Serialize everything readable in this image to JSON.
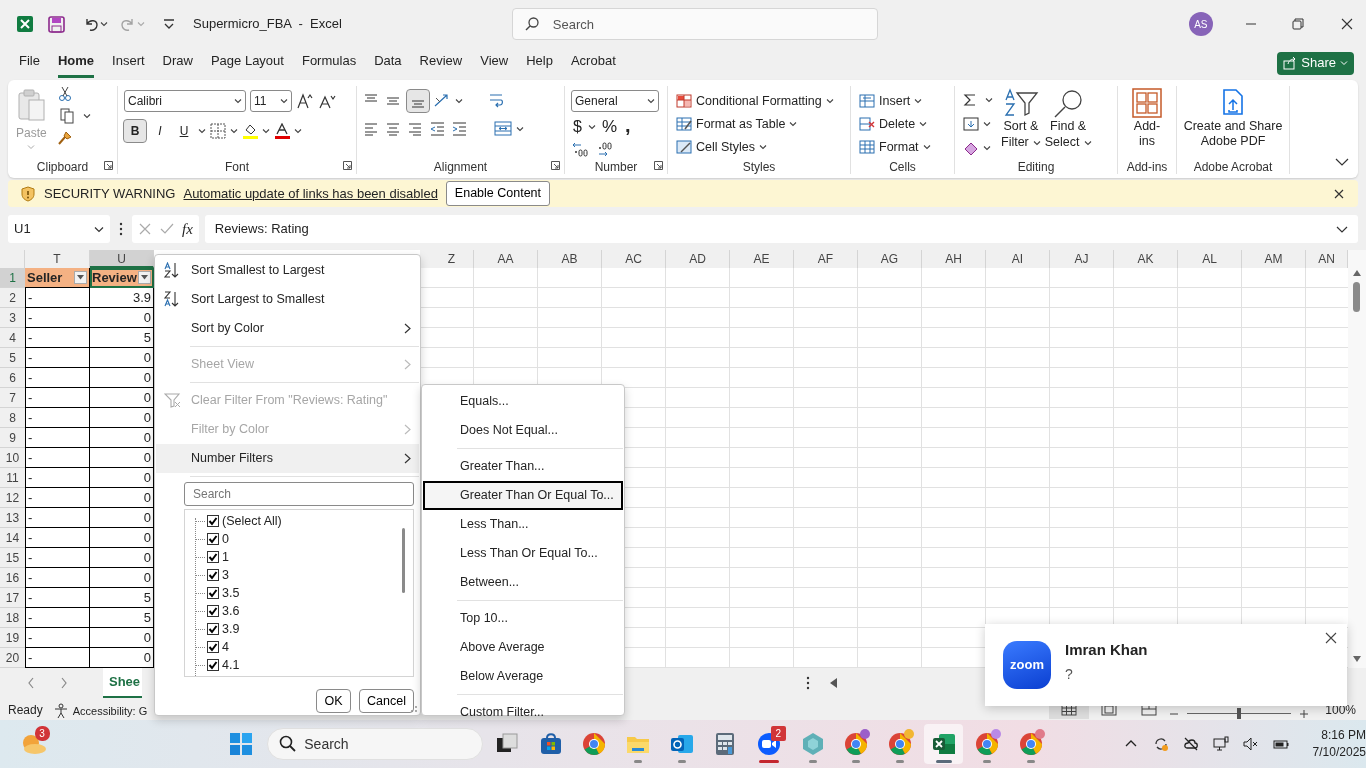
{
  "window": {
    "title": "Supermicro_FBA  -  Excel",
    "search_placeholder": "Search",
    "avatar": "AS"
  },
  "ribbon_tabs": [
    {
      "label": "File",
      "selected": false
    },
    {
      "label": "Home",
      "selected": true
    },
    {
      "label": "Insert",
      "selected": false
    },
    {
      "label": "Draw",
      "selected": false
    },
    {
      "label": "Page Layout",
      "selected": false
    },
    {
      "label": "Formulas",
      "selected": false
    },
    {
      "label": "Data",
      "selected": false
    },
    {
      "label": "Review",
      "selected": false
    },
    {
      "label": "View",
      "selected": false
    },
    {
      "label": "Help",
      "selected": false
    },
    {
      "label": "Acrobat",
      "selected": false
    }
  ],
  "share": "Share",
  "ribbon": {
    "clipboard": {
      "label": "Clipboard",
      "paste": "Paste"
    },
    "font": {
      "label": "Font",
      "name": "Calibri",
      "size": "11",
      "bold": "B",
      "italic": "I",
      "underline": "U",
      "bold_on": true
    },
    "alignment": {
      "label": "Alignment",
      "bottom_align_on": true
    },
    "number": {
      "label": "Number",
      "format": "General",
      "currency": "$",
      "percent": "%",
      "comma": ","
    },
    "styles": {
      "label": "Styles",
      "commands": [
        "Conditional Formatting",
        "Format as Table",
        "Cell Styles"
      ]
    },
    "cells": {
      "label": "Cells",
      "commands": [
        "Insert",
        "Delete",
        "Format"
      ]
    },
    "editing": {
      "label": "Editing",
      "sort_lines": [
        "Sort &",
        "Filter"
      ],
      "find_lines": [
        "Find &",
        "Select"
      ]
    },
    "addins": {
      "label": "Add-ins",
      "button": "Add-ins"
    },
    "acrobat": {
      "label": "Adobe Acrobat",
      "button": "Create and Share Adobe PDF"
    }
  },
  "security_bar": {
    "title": "SECURITY WARNING",
    "message": "Automatic update of links has been disabled",
    "button": "Enable Content"
  },
  "formula_bar": {
    "name_box": "U1",
    "fx": "fx",
    "formula": "Reviews: Rating"
  },
  "sheet": {
    "columns_left": [
      "T",
      "U"
    ],
    "columns_right": [
      "Z",
      "AA",
      "AB",
      "AC",
      "AD",
      "AE",
      "AF",
      "AG",
      "AH",
      "AI",
      "AJ",
      "AK",
      "AL",
      "AM",
      "AN"
    ],
    "header_row": {
      "number": "1",
      "cells": [
        {
          "text": "Seller",
          "selected": false
        },
        {
          "text": "Review",
          "selected": true
        }
      ]
    },
    "rows": [
      {
        "number": "2",
        "t": "-",
        "u": "3.9"
      },
      {
        "number": "3",
        "t": "-",
        "u": "0"
      },
      {
        "number": "4",
        "t": "-",
        "u": "5"
      },
      {
        "number": "5",
        "t": "-",
        "u": "0"
      },
      {
        "number": "6",
        "t": "-",
        "u": "0"
      },
      {
        "number": "7",
        "t": "-",
        "u": "0"
      },
      {
        "number": "8",
        "t": "-",
        "u": "0"
      },
      {
        "number": "9",
        "t": "-",
        "u": "0"
      },
      {
        "number": "10",
        "t": "-",
        "u": "0"
      },
      {
        "number": "11",
        "t": "-",
        "u": "0"
      },
      {
        "number": "12",
        "t": "-",
        "u": "0"
      },
      {
        "number": "13",
        "t": "-",
        "u": "0"
      },
      {
        "number": "14",
        "t": "-",
        "u": "0"
      },
      {
        "number": "15",
        "t": "-",
        "u": "0"
      },
      {
        "number": "16",
        "t": "-",
        "u": "0"
      },
      {
        "number": "17",
        "t": "-",
        "u": "5"
      },
      {
        "number": "18",
        "t": "-",
        "u": "5"
      },
      {
        "number": "19",
        "t": "-",
        "u": "0"
      },
      {
        "number": "20",
        "t": "-",
        "u": "0"
      }
    ],
    "sheet_tab": "Shee"
  },
  "filter_menu": {
    "items": [
      {
        "kind": "sort_asc",
        "label": "Sort Smallest to Largest",
        "disabled": false,
        "submenu": false,
        "highlighted": false
      },
      {
        "kind": "sort_desc",
        "label": "Sort Largest to Smallest",
        "disabled": false,
        "submenu": false,
        "highlighted": false
      },
      {
        "kind": "command",
        "label": "Sort by Color",
        "disabled": false,
        "submenu": true,
        "highlighted": false
      },
      {
        "kind": "separator"
      },
      {
        "kind": "command",
        "label": "Sheet View",
        "disabled": true,
        "submenu": true,
        "highlighted": false
      },
      {
        "kind": "separator"
      },
      {
        "kind": "clear_filter",
        "label": "Clear Filter From \"Reviews: Rating\"",
        "disabled": true,
        "submenu": false,
        "highlighted": false
      },
      {
        "kind": "command",
        "label": "Filter by Color",
        "disabled": true,
        "submenu": true,
        "highlighted": false
      },
      {
        "kind": "command",
        "label": "Number Filters",
        "disabled": false,
        "submenu": true,
        "highlighted": true
      },
      {
        "kind": "separator"
      }
    ],
    "search_placeholder": "Search",
    "values": [
      {
        "label": "(Select All)",
        "checked": true
      },
      {
        "label": "0",
        "checked": true
      },
      {
        "label": "1",
        "checked": true
      },
      {
        "label": "3",
        "checked": true
      },
      {
        "label": "3.5",
        "checked": true
      },
      {
        "label": "3.6",
        "checked": true
      },
      {
        "label": "3.9",
        "checked": true
      },
      {
        "label": "4",
        "checked": true
      },
      {
        "label": "4.1",
        "checked": true
      }
    ],
    "ok": "OK",
    "cancel": "Cancel"
  },
  "number_filters": [
    {
      "kind": "command",
      "label": "Equals...",
      "focused": false
    },
    {
      "kind": "command",
      "label": "Does Not Equal...",
      "focused": false
    },
    {
      "kind": "separator"
    },
    {
      "kind": "command",
      "label": "Greater Than...",
      "focused": false
    },
    {
      "kind": "command",
      "label": "Greater Than Or Equal To...",
      "focused": true
    },
    {
      "kind": "command",
      "label": "Less Than...",
      "focused": false
    },
    {
      "kind": "command",
      "label": "Less Than Or Equal To...",
      "focused": false
    },
    {
      "kind": "command",
      "label": "Between...",
      "focused": false
    },
    {
      "kind": "separator"
    },
    {
      "kind": "command",
      "label": "Top 10...",
      "focused": false
    },
    {
      "kind": "command",
      "label": "Above Average",
      "focused": false
    },
    {
      "kind": "command",
      "label": "Below Average",
      "focused": false
    },
    {
      "kind": "separator"
    },
    {
      "kind": "command",
      "label": "Custom Filter...",
      "focused": false
    }
  ],
  "status_bar": {
    "ready": "Ready",
    "accessibility": "Accessibility: G",
    "views": [
      {
        "kind": "normal",
        "selected": true
      },
      {
        "kind": "page_layout",
        "selected": false
      },
      {
        "kind": "page_break",
        "selected": false
      }
    ],
    "zoom": {
      "level": 0.5,
      "reading": "100%"
    }
  },
  "notification": {
    "logo": "zoom",
    "name": "Imran Khan",
    "message": "?"
  },
  "taskbar": {
    "weather_badge": "3",
    "search_placeholder": "Search",
    "apps": [
      {
        "kind": "taskview",
        "running": false,
        "active": false
      },
      {
        "kind": "store",
        "running": false,
        "active": false
      },
      {
        "kind": "chrome",
        "running": false,
        "active": false
      },
      {
        "kind": "explorer",
        "running": true,
        "active": false
      },
      {
        "kind": "outlook",
        "running": true,
        "active": false
      },
      {
        "kind": "calculator",
        "running": false,
        "active": false
      },
      {
        "kind": "zoom",
        "running": true,
        "active": false,
        "badge": "2"
      },
      {
        "kind": "gem",
        "running": true,
        "active": false
      },
      {
        "kind": "chrome",
        "running": true,
        "active": false,
        "color": "#9b5fc9"
      },
      {
        "kind": "chrome",
        "running": true,
        "active": false,
        "color": "#f2b632"
      },
      {
        "kind": "excel",
        "running": true,
        "active": true
      },
      {
        "kind": "chrome",
        "running": true,
        "active": false,
        "color": "#b98ae6"
      },
      {
        "kind": "chrome",
        "running": true,
        "active": false,
        "color": "#e07a8a"
      }
    ],
    "time": "8:16 PM",
    "date": "7/10/2025"
  }
}
